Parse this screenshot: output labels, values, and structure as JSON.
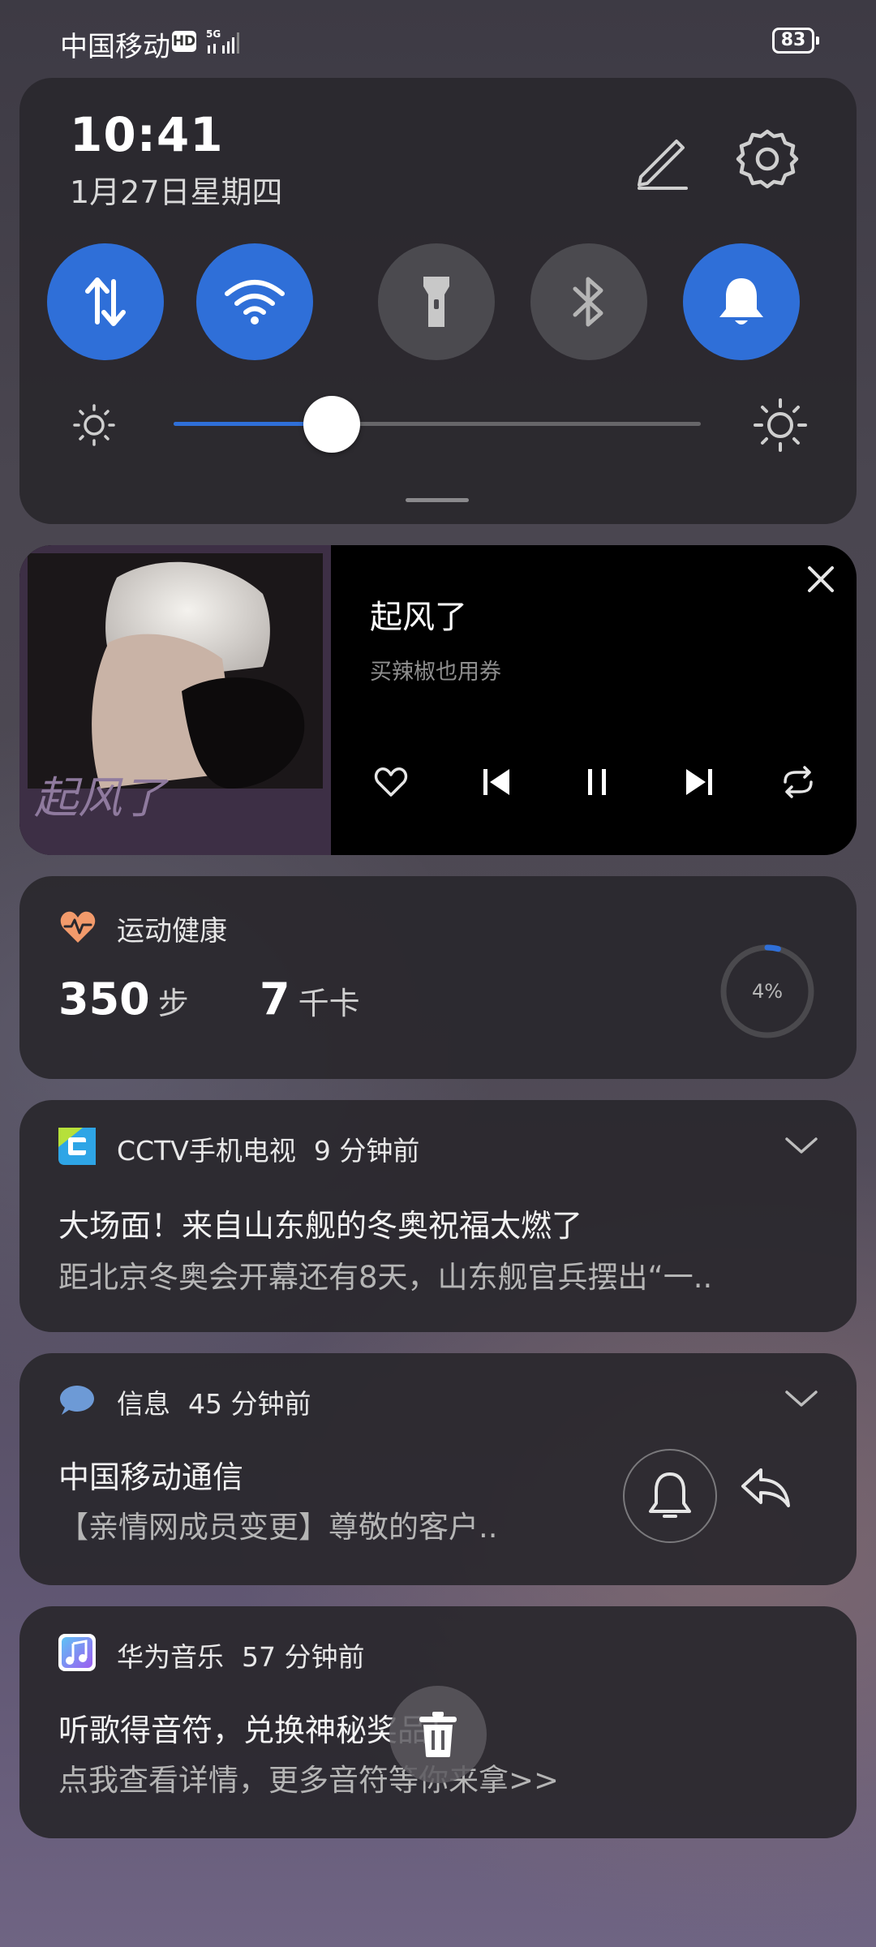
{
  "status_bar": {
    "carrier": "中国移动",
    "hd_badge": "HD",
    "network": "5G",
    "battery": "83"
  },
  "quick_settings": {
    "time": "10:41",
    "date": "1月27日星期四",
    "tiles": [
      {
        "name": "mobile-data",
        "icon": "data-arrows-icon",
        "active": true
      },
      {
        "name": "wifi",
        "icon": "wifi-icon",
        "active": true
      },
      {
        "name": "flashlight",
        "icon": "flashlight-icon",
        "active": false
      },
      {
        "name": "bluetooth",
        "icon": "bluetooth-icon",
        "active": false
      },
      {
        "name": "sound",
        "icon": "bell-icon",
        "active": true
      }
    ],
    "brightness_level": 0.3,
    "accent_color": "#2f6fd8"
  },
  "music_player": {
    "title": "起风了",
    "artist": "买辣椒也用券",
    "cover_text": "起风了",
    "controls": [
      "heart-icon",
      "previous-icon",
      "pause-icon",
      "next-icon",
      "repeat-icon"
    ]
  },
  "health": {
    "app": "运动健康",
    "steps_value": "350",
    "steps_unit": "步",
    "calories_value": "7",
    "calories_unit": "千卡",
    "progress_text": "4%",
    "progress": 0.04
  },
  "notifications": {
    "cctv": {
      "app": "CCTV手机电视",
      "time": "9 分钟前",
      "title": "大场面！来自山东舰的冬奥祝福太燃了",
      "body": "距北京冬奥会开幕还有8天，山东舰官兵摆出“一.."
    },
    "sms": {
      "app": "信息",
      "time": "45 分钟前",
      "title": "中国移动通信",
      "body": "【亲情网成员变更】尊敬的客户.."
    },
    "huawei_music": {
      "app": "华为音乐",
      "time": "57 分钟前",
      "title": "听歌得音符，兑换神秘奖品！",
      "body": "点我查看详情，更多音符等你来拿>>"
    }
  }
}
